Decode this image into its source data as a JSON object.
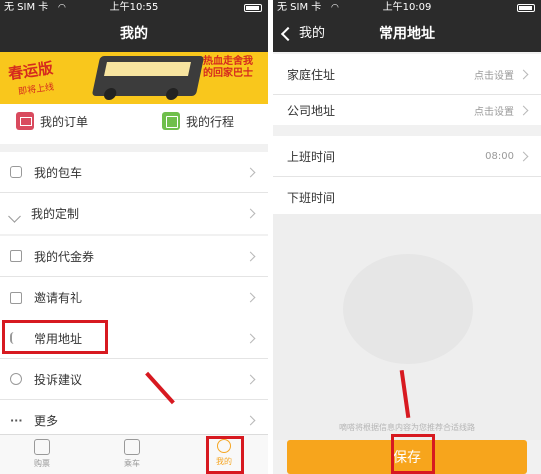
{
  "left_screen": {
    "status": {
      "carrier": "无 SIM 卡",
      "time": "上午10:55"
    },
    "title": "我的",
    "banner": {
      "headline": "春运版",
      "subline": "即将上线",
      "slogan": "热血走舍我的回家巴士"
    },
    "quick_links": [
      {
        "label": "我的订单",
        "icon": "order-icon"
      },
      {
        "label": "我的行程",
        "icon": "trip-icon"
      }
    ],
    "group1": [
      {
        "label": "我的包车",
        "icon": "bus-icon"
      },
      {
        "label": "我的定制",
        "icon": "custom-route-icon"
      }
    ],
    "group2": [
      {
        "label": "我的代金券",
        "icon": "coupon-icon"
      },
      {
        "label": "邀请有礼",
        "icon": "gift-icon"
      }
    ],
    "group3": [
      {
        "label": "常用地址",
        "icon": "address-icon"
      },
      {
        "label": "投诉建议",
        "icon": "feedback-icon"
      },
      {
        "label": "更多",
        "icon": "more-icon"
      }
    ],
    "tabs": [
      {
        "label": "购票",
        "icon": "ticket-icon"
      },
      {
        "label": "乘车",
        "icon": "ride-icon"
      },
      {
        "label": "我的",
        "icon": "profile-icon",
        "active": true
      }
    ]
  },
  "right_screen": {
    "status": {
      "carrier": "无 SIM 卡",
      "time": "上午10:09"
    },
    "back_label": "我的",
    "title": "常用地址",
    "addresses": [
      {
        "label": "家庭住址",
        "value": "点击设置"
      },
      {
        "label": "公司地址",
        "value": "点击设置"
      }
    ],
    "times": [
      {
        "label": "上班时间",
        "value": "08:00"
      },
      {
        "label": "下班时间",
        "value": ""
      }
    ],
    "hint": "嘀嗒将根据信息内容为您推荐合适线路",
    "save_label": "保存"
  },
  "colors": {
    "accent": "#f7a51c",
    "highlight": "#d71920",
    "navbar": "#2b2b2b"
  }
}
